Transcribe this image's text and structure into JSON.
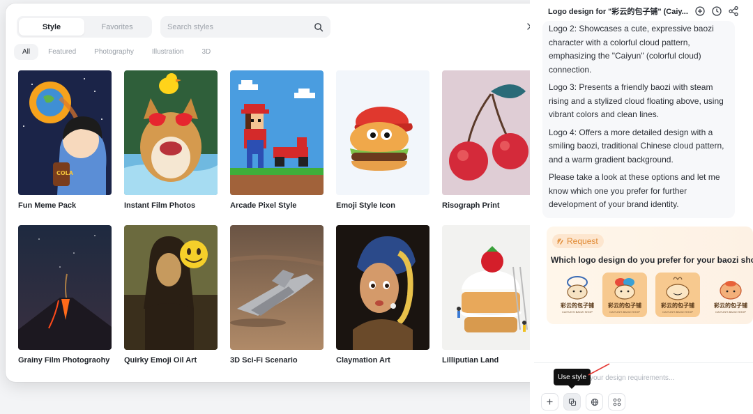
{
  "style_picker": {
    "tabs": [
      {
        "label": "Style",
        "active": true
      },
      {
        "label": "Favorites",
        "active": false
      }
    ],
    "search_placeholder": "Search styles",
    "filters": [
      {
        "label": "All",
        "active": true
      },
      {
        "label": "Featured",
        "active": false
      },
      {
        "label": "Photography",
        "active": false
      },
      {
        "label": "Illustration",
        "active": false
      },
      {
        "label": "3D",
        "active": false
      }
    ],
    "styles": [
      {
        "label": "Fun Meme Pack"
      },
      {
        "label": "Instant Film Photos"
      },
      {
        "label": "Arcade Pixel Style"
      },
      {
        "label": "Emoji Style Icon"
      },
      {
        "label": "Risograph Print"
      },
      {
        "label": "Grainy Film Photograohy"
      },
      {
        "label": "Quirky Emoji Oil Art"
      },
      {
        "label": "3D Sci-Fi Scenario"
      },
      {
        "label": "Claymation Art"
      },
      {
        "label": "Lilliputian Land"
      }
    ]
  },
  "chat": {
    "title": "Logo design for \"彩云的包子铺\" (Caiy...",
    "message": [
      "Logo 2: Showcases a cute, expressive baozi character with a colorful cloud pattern, emphasizing the \"Caiyun\" (colorful cloud) connection.",
      "Logo 3: Presents a friendly baozi with steam rising and a stylized cloud floating above, using vibrant colors and clean lines.",
      "Logo 4: Offers a more detailed design with a smiling baozi, traditional Chinese cloud pattern, and a warm gradient background.",
      "Please take a look at these options and let me know which one you prefer for further development of your brand identity."
    ],
    "request": {
      "badge": "Request",
      "question": "Which logo design do you prefer for your baozi shop?",
      "logos": [
        {
          "name": "彩云的包子铺",
          "sub": "CAIYUN'S BAOZI SHOP",
          "selected": false
        },
        {
          "name": "彩云的包子铺",
          "sub": "CAIYUN'S BAOZI SHOP",
          "selected": true
        },
        {
          "name": "彩云的包子铺",
          "sub": "CAIYUN'S BAOZI SHOP",
          "selected": true
        },
        {
          "name": "彩云的包子铺",
          "sub": "CAIYUN'S BAOZI SHOP",
          "selected": false
        }
      ]
    },
    "input_placeholder": "your design requirements...",
    "tooltip": "Use style"
  },
  "colors": {
    "accent_orange": "#e08a33",
    "request_bg": "#fff6ea",
    "annotation_red": "#e53935"
  }
}
